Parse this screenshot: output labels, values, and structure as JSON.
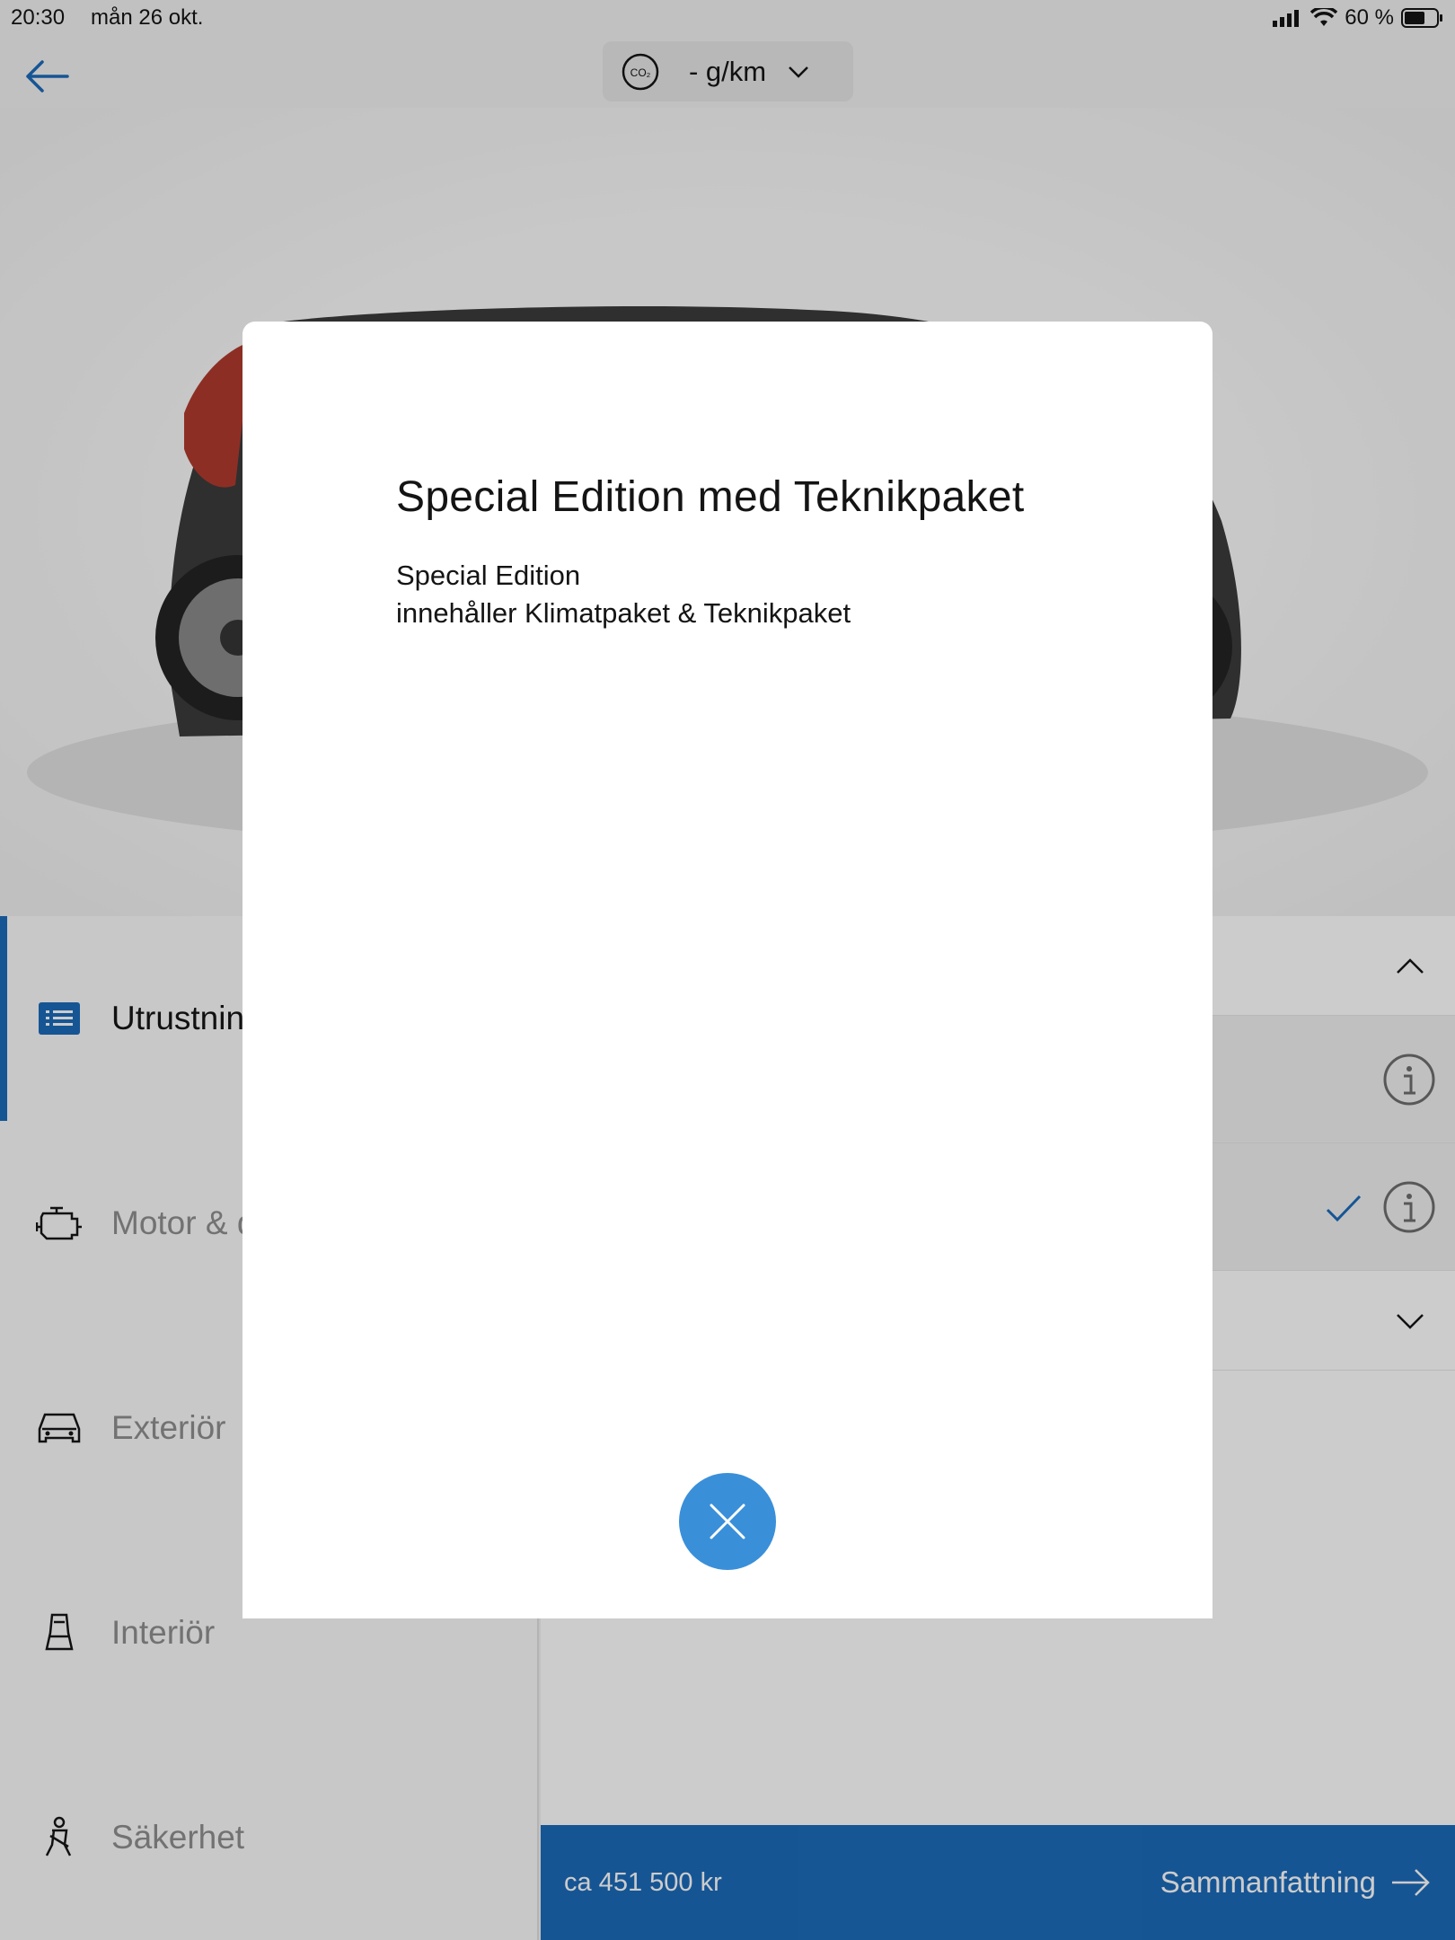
{
  "status_bar": {
    "time": "20:30",
    "date": "mån 26 okt.",
    "battery": "60 %"
  },
  "header": {
    "co2_badge": "CO₂",
    "co2_value": "- g/km"
  },
  "left_nav": {
    "items": [
      {
        "label": "Utrustning",
        "icon": "list-icon",
        "active": true
      },
      {
        "label": "Motor & drivlina",
        "icon": "engine-icon",
        "active": false
      },
      {
        "label": "Exteriör",
        "icon": "car-front-icon",
        "active": false
      },
      {
        "label": "Interiör",
        "icon": "seat-icon",
        "active": false
      },
      {
        "label": "Säkerhet",
        "icon": "seatbelt-icon",
        "active": false
      }
    ]
  },
  "footer": {
    "price": "ca 451 500 kr",
    "summary_label": "Sammanfattning"
  },
  "modal": {
    "title": "Special Edition med Teknikpaket",
    "body_line1": "Special Edition",
    "body_line2": "innehåller Klimatpaket & Teknikpaket"
  },
  "colors": {
    "accent": "#1c6bba",
    "close_button": "#3a8fd9",
    "overlay": "rgba(0,0,0,0.2)"
  }
}
